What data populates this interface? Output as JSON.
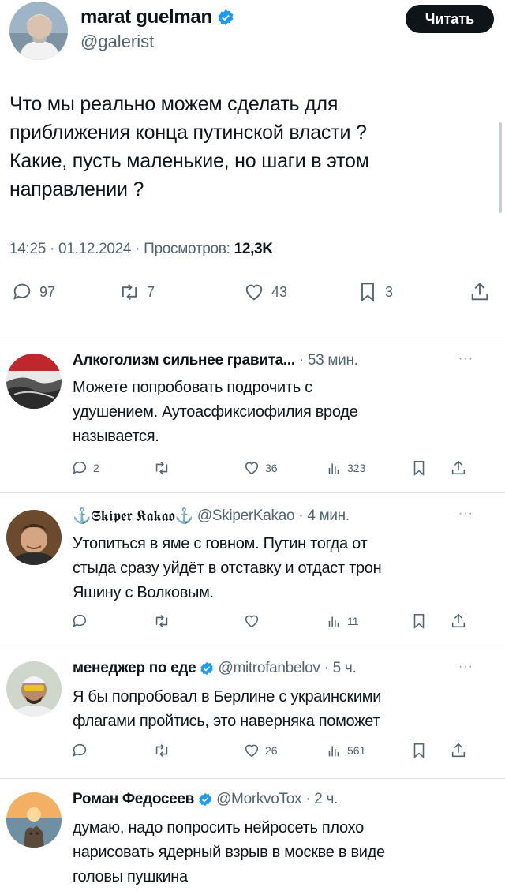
{
  "main_tweet": {
    "author_name": "marat guelman",
    "handle": "@galerist",
    "follow_label": "Читать",
    "text_lines": [
      "Что мы реально можем сделать для",
      "приближения конца путинской власти ?",
      "Какие, пусть маленькие, но шаги в этом",
      "направлении ?"
    ],
    "time": "14:25",
    "date": "01.12.2024",
    "views_label": "Просмотров:",
    "views": "12,3K",
    "replies": "97",
    "retweets": "7",
    "likes": "43",
    "bookmarks": "3"
  },
  "replies": [
    {
      "author_name": "Алкоголизм сильнее гравита...",
      "handle": "",
      "time": "53 мин.",
      "verified": false,
      "text_lines": [
        "Можете попробовать подрочить с",
        "удушением. Аутоасфиксиофилия вроде",
        "называется."
      ],
      "replies": "2",
      "retweets": "",
      "likes": "36",
      "views": "323"
    },
    {
      "author_name": "⚓𝕾𝖐𝖎𝖕𝖊𝖗 𝕶𝖆𝖐𝖆𝖔⚓",
      "handle": "@SkiperKakao",
      "time": "4 мин.",
      "verified": false,
      "text_lines": [
        "Утопиться в яме с говном. Путин тогда от",
        "стыда сразу уйдёт в отставку и отдаст трон",
        "Яшину с Волковым."
      ],
      "replies": "",
      "retweets": "",
      "likes": "",
      "views": "11"
    },
    {
      "author_name": "менеджер по еде",
      "handle": "@mitrofanbelov",
      "time": "5 ч.",
      "verified": true,
      "text_lines": [
        "Я бы попробовал в Берлине с украинскими",
        "флагами пройтись, это наверняка поможет"
      ],
      "replies": "",
      "retweets": "",
      "likes": "26",
      "views": "561"
    },
    {
      "author_name": "Роман Федосеев",
      "handle": "@MorkvoTox",
      "time": "2 ч.",
      "verified": true,
      "text_lines": [
        "думаю, надо попросить нейросеть плохо",
        "нарисовать ядерный взрыв в москве в виде",
        "головы пушкина"
      ]
    }
  ],
  "icons": {
    "reply": "speech-bubble-icon",
    "retweet": "retweet-arrows-icon",
    "like": "heart-icon",
    "views": "bar-chart-icon",
    "bookmark": "bookmark-icon",
    "share": "share-upload-icon",
    "verified": "verified-badge-icon",
    "more": "more-dots-icon"
  },
  "colors": {
    "verified_blue": "#1d9bf0",
    "text": "#0f1419",
    "muted": "#536471",
    "button_bg": "#0f1419"
  }
}
